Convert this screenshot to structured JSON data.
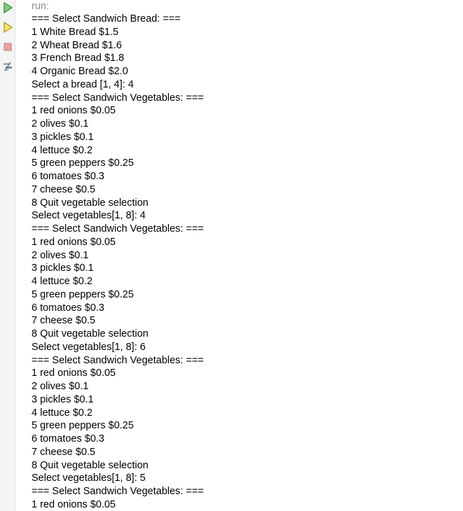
{
  "toolbar": {
    "buttons": [
      {
        "name": "rerun-icon",
        "color": "#3aa63a"
      },
      {
        "name": "rerun-with-options-icon",
        "color": "#d8b400"
      },
      {
        "name": "stop-icon",
        "color": "#e07a7a"
      },
      {
        "name": "settings-icon",
        "color": "#7a8a9a"
      }
    ]
  },
  "output": {
    "header": "run:",
    "lines": [
      "=== Select Sandwich Bread: ===",
      "1 White Bread $1.5",
      "2 Wheat Bread $1.6",
      "3 French Bread $1.8",
      "4 Organic Bread $2.0",
      "Select a bread [1, 4]: 4",
      "=== Select Sandwich Vegetables: ===",
      "1 red onions $0.05",
      "2 olives $0.1",
      "3 pickles $0.1",
      "4 lettuce $0.2",
      "5 green peppers $0.25",
      "6 tomatoes $0.3",
      "7 cheese $0.5",
      "8 Quit vegetable selection",
      "Select vegetables[1, 8]: 4",
      "=== Select Sandwich Vegetables: ===",
      "1 red onions $0.05",
      "2 olives $0.1",
      "3 pickles $0.1",
      "4 lettuce $0.2",
      "5 green peppers $0.25",
      "6 tomatoes $0.3",
      "7 cheese $0.5",
      "8 Quit vegetable selection",
      "Select vegetables[1, 8]: 6",
      "=== Select Sandwich Vegetables: ===",
      "1 red onions $0.05",
      "2 olives $0.1",
      "3 pickles $0.1",
      "4 lettuce $0.2",
      "5 green peppers $0.25",
      "6 tomatoes $0.3",
      "7 cheese $0.5",
      "8 Quit vegetable selection",
      "Select vegetables[1, 8]: 5",
      "=== Select Sandwich Vegetables: ===",
      "1 red onions $0.05"
    ]
  }
}
